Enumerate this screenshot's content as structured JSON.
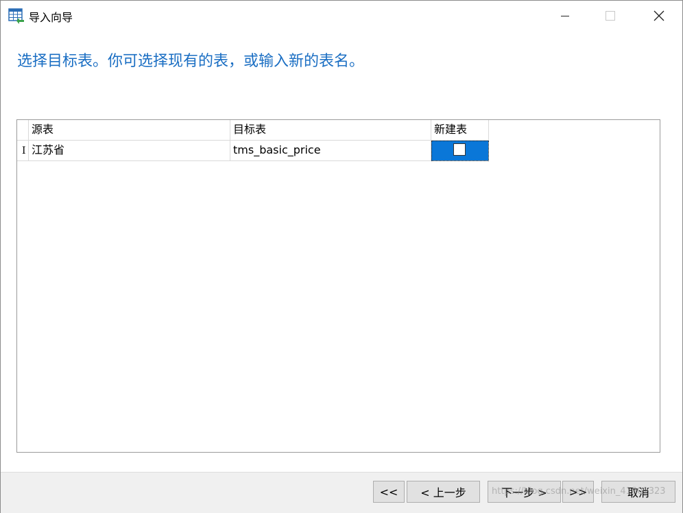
{
  "window": {
    "title": "导入向导",
    "icon": "table-import-icon"
  },
  "heading": "选择目标表。你可选择现有的表，或输入新的表名。",
  "grid": {
    "columns": [
      "源表",
      "目标表",
      "新建表"
    ],
    "rows": [
      {
        "indicator": "I",
        "source": "江苏省",
        "target": "tms_basic_price",
        "new_table": false
      }
    ]
  },
  "footer": {
    "first_label": "<<",
    "prev_label": "< 上一步",
    "next_label": "下一步 >",
    "last_label": ">>",
    "cancel_label": "取消",
    "watermark": "https://blog.csdn.net/weixin_41801323"
  },
  "colors": {
    "heading": "#1a6ec3",
    "selected_cell": "#0a77d8",
    "footer_bg": "#f0f0f0",
    "button_bg": "#e1e1e1"
  }
}
